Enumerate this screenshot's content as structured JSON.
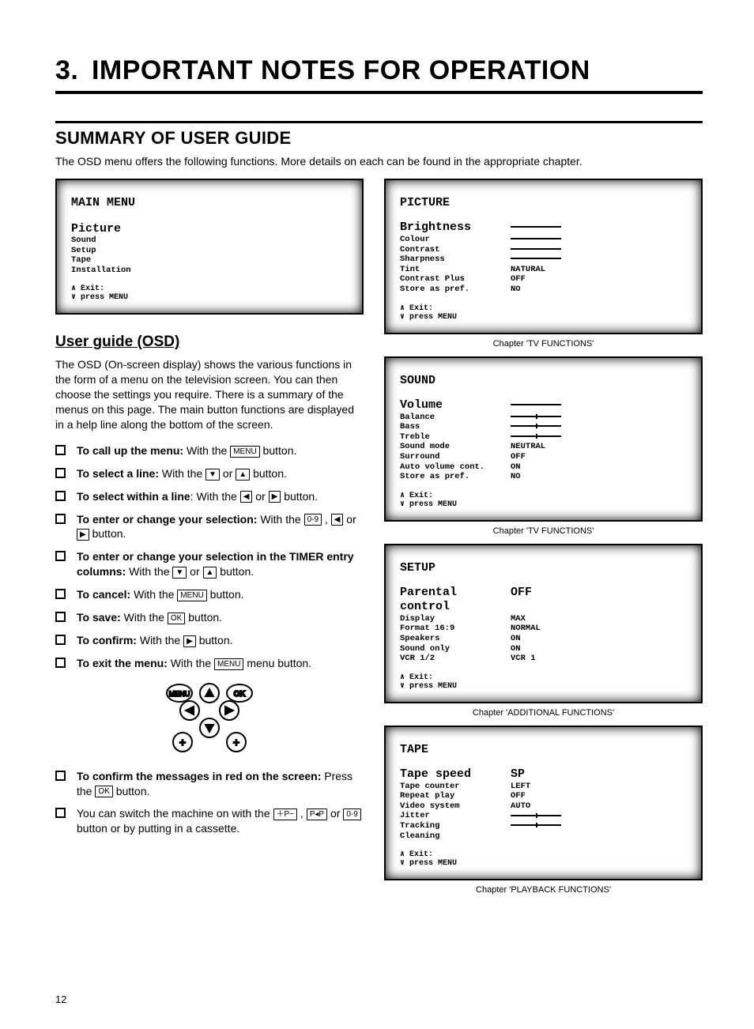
{
  "section_number": "3.",
  "section_title": "IMPORTANT NOTES FOR OPERATION",
  "summary_head": "SUMMARY OF USER GUIDE",
  "intro": "The OSD menu offers the following functions. More details on each can be found in the appropriate chapter.",
  "main_menu": {
    "title": "MAIN MENU",
    "selected": "Picture",
    "items": [
      "Sound",
      "Setup",
      "Tape",
      "Installation"
    ],
    "exit1": "∧ Exit:",
    "exit2": "∨ press MENU"
  },
  "user_guide_head": "User guide (OSD)",
  "user_guide_para": "The OSD (On-screen display) shows the various functions in the form of a menu on the television screen. You can then choose the settings you require. There is a summary of the menus on this page. The main button functions are displayed in a help line along the bottom of the screen.",
  "steps": {
    "s1a": "To call up the menu:",
    "s1b": " With the ",
    "s1c": " button.",
    "s2a": "To select a line:",
    "s2b": " With the ",
    "s2c": " or ",
    "s2d": " button.",
    "s3a": "To select within a line",
    "s3b": ": With the ",
    "s3c": " or ",
    "s3d": " button.",
    "s4a": "To enter or change your selection:",
    "s4b": " With the ",
    "s4c": " , ",
    "s4d": " or ",
    "s4e": " button.",
    "s5a": "To enter or change your selection in the TIMER entry columns:",
    "s5b": " With the ",
    "s5c": " or ",
    "s5d": " button.",
    "s6a": "To cancel:",
    "s6b": " With the ",
    "s6c": " button.",
    "s7a": "To save:",
    "s7b": " With the ",
    "s7c": " button.",
    "s8a": "To confirm:",
    "s8b": " With the ",
    "s8c": " button.",
    "s9a": "To exit the menu:",
    "s9b": " With the ",
    "s9c": " menu button.",
    "s10a": "To confirm the messages in red on the screen:",
    "s10b": " Press the ",
    "s10c": " button.",
    "s11a": "You can switch the machine on with the ",
    "s11b": " , ",
    "s11c": " or ",
    "s11d": " button or by putting in a cassette."
  },
  "btn_labels": {
    "menu": "MENU",
    "ok": "OK",
    "num": "0-9",
    "pplus": "＋P−",
    "prev": "P◂P"
  },
  "picture": {
    "title": "PICTURE",
    "selected": "Brightness",
    "rows": [
      {
        "lbl": "Colour",
        "val": "__line__"
      },
      {
        "lbl": "Contrast",
        "val": "__line__"
      },
      {
        "lbl": "Sharpness",
        "val": "__line__"
      },
      {
        "lbl": "Tint",
        "val": "NATURAL"
      },
      {
        "lbl": "Contrast Plus",
        "val": "OFF"
      },
      {
        "lbl": "Store as pref.",
        "val": "NO"
      }
    ],
    "sel_val": "__line__",
    "exit1": "∧ Exit:",
    "exit2": "∨ press MENU",
    "caption": "Chapter 'TV FUNCTIONS'"
  },
  "sound": {
    "title": "SOUND",
    "selected": "Volume",
    "sel_val": "__line__",
    "rows": [
      {
        "lbl": "Balance",
        "val": "__slider__"
      },
      {
        "lbl": "Bass",
        "val": "__slider__"
      },
      {
        "lbl": "Treble",
        "val": "__slider__"
      },
      {
        "lbl": "Sound mode",
        "val": "NEUTRAL"
      },
      {
        "lbl": "Surround",
        "val": "OFF"
      },
      {
        "lbl": "Auto volume cont.",
        "val": "ON"
      },
      {
        "lbl": "Store as pref.",
        "val": "NO"
      }
    ],
    "exit1": "∧ Exit:",
    "exit2": "∨ press MENU",
    "caption": "Chapter 'TV FUNCTIONS'"
  },
  "setup": {
    "title": "SETUP",
    "selected": "Parental control",
    "sel_val": "OFF",
    "rows": [
      {
        "lbl": "Display",
        "val": "MAX"
      },
      {
        "lbl": "Format 16:9",
        "val": "NORMAL"
      },
      {
        "lbl": "Speakers",
        "val": "ON"
      },
      {
        "lbl": "Sound only",
        "val": "ON"
      },
      {
        "lbl": "VCR 1/2",
        "val": "VCR 1"
      }
    ],
    "exit1": "∧ Exit:",
    "exit2": "∨ press MENU",
    "caption": "Chapter 'ADDITIONAL FUNCTIONS'"
  },
  "tape": {
    "title": "TAPE",
    "selected": "Tape speed",
    "sel_val": "SP",
    "rows": [
      {
        "lbl": "Tape counter",
        "val": "LEFT"
      },
      {
        "lbl": "Repeat play",
        "val": "OFF"
      },
      {
        "lbl": "Video system",
        "val": "AUTO"
      },
      {
        "lbl": "Jitter",
        "val": "__slider__"
      },
      {
        "lbl": "Tracking",
        "val": "__slider__"
      },
      {
        "lbl": "Cleaning",
        "val": ""
      }
    ],
    "exit1": "∧ Exit:",
    "exit2": "∨ press MENU",
    "caption": "Chapter 'PLAYBACK FUNCTIONS'"
  },
  "page_num": "12"
}
